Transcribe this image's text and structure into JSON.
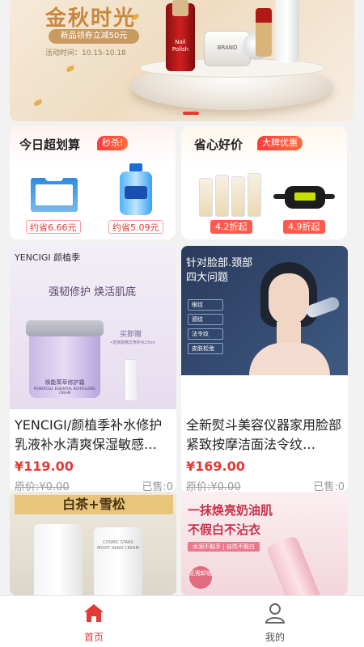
{
  "banner": {
    "title": "金秋时光",
    "coupon": "新品领券立减50元",
    "date": "活动时间：10.15-10.18",
    "product_label_1": "Nail Polish",
    "product_label_2": "BRAND",
    "active_slide": 1
  },
  "promo_left": {
    "title": "今日超划算",
    "badge": "秒杀!",
    "items": [
      {
        "save": "约省6.66元"
      },
      {
        "save": "约省5.09元"
      }
    ]
  },
  "promo_right": {
    "title": "省心好价",
    "badge": "大牌优惠",
    "items": [
      {
        "discount": "4.2折起"
      },
      {
        "discount": "4.9折起"
      }
    ]
  },
  "products": [
    {
      "image_brand": "YENCIGI 颜植季",
      "image_slogan": "强韧修护 焕活肌底",
      "image_box_label": "焕能菁萃修护霜",
      "image_box_sub": "POWERCELL ESSENTIAL REVITALIZING CREAM",
      "image_gift": "买即赠",
      "image_gift_sub": "•送焕能精华修护水15ml",
      "name": "YENCIGI/颜植季补水修护乳液补水清爽保湿敏感…",
      "price": "¥119.00",
      "orig": "原价:¥0.00",
      "sold": "已售:0"
    },
    {
      "image_title_1": "针对脸部.颈部",
      "image_title_2": "四大问题",
      "image_list": [
        "眼纹",
        "颈纹",
        "法令纹",
        "皮肤松弛"
      ],
      "name": "全新熨斗美容仪器家用脸部紧致按摩洁面法令纹…",
      "price": "¥169.00",
      "orig": "原价:¥0.00",
      "sold": "已售:0"
    },
    {
      "image_title": "白茶+雪松",
      "image_tube_text": "COSMIC STARS MOIST HAND CREAM"
    },
    {
      "image_title_1": "一抹焕亮奶油肌",
      "image_title_2": "不假白不沾衣",
      "image_sub": "水润不黏手 | 自然不假白",
      "image_badge": "无需卸妆"
    }
  ],
  "nav": {
    "home": "首页",
    "mine": "我的",
    "active_color": "#e53935"
  }
}
